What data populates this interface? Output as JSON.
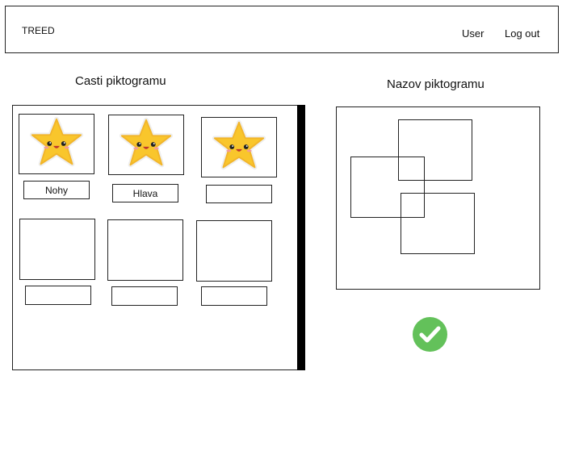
{
  "header": {
    "brand": "TREED",
    "user": "User",
    "logout": "Log out"
  },
  "parts_panel": {
    "title": "Casti piktogramu",
    "tiles": [
      {
        "icon": "star-face-icon",
        "label": "Nohy"
      },
      {
        "icon": "star-face-icon",
        "label": "Hlava"
      },
      {
        "icon": "star-face-icon",
        "label": ""
      },
      {
        "icon": "",
        "label": ""
      },
      {
        "icon": "",
        "label": ""
      },
      {
        "icon": "",
        "label": ""
      }
    ]
  },
  "pictogram_panel": {
    "title": "Nazov piktogramu"
  },
  "confirm": {
    "icon": "checkmark-icon",
    "color": "#63c15a"
  },
  "colors": {
    "star": "#f9c62c",
    "star_shade": "#f2a81d",
    "border": "#222222"
  }
}
